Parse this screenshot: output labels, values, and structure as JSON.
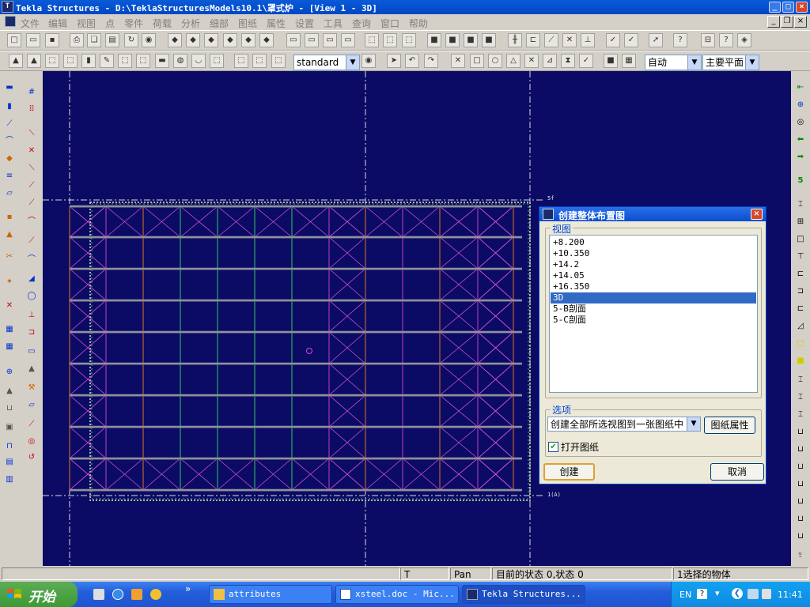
{
  "window": {
    "title": "Tekla Structures - D:\\TeklaStructuresModels10.1\\罩式炉 - [View 1 - 3D]"
  },
  "menu": [
    "文件",
    "编辑",
    "视图",
    "点",
    "零件",
    "荷载",
    "分析",
    "细部",
    "图纸",
    "属性",
    "设置",
    "工具",
    "查询",
    "窗口",
    "帮助"
  ],
  "toolbar2": {
    "standard_select": "standard",
    "auto_select": "自动",
    "plane_select": "主要平面"
  },
  "viewport": {
    "axis_label_top": "5f",
    "axis_label_bottom": "1(A)"
  },
  "dialog": {
    "title": "创建整体布置图",
    "views_group": "视图",
    "views": [
      "+8.200",
      "+10.350",
      "+14.2",
      "+14.05",
      "+16.350",
      "3D",
      "5-B剖面",
      "5-C剖面"
    ],
    "selected_view": "3D",
    "options_group": "选项",
    "option_select": "创建全部所选视图到一张图纸中",
    "drawing_props_button": "图纸属性",
    "open_drawing_checkbox": "打开图纸",
    "open_drawing_checked": true,
    "create_button": "创建",
    "cancel_button": "取消"
  },
  "statusbar": {
    "t_field": "T",
    "pan_field": "Pan",
    "state_field": "目前的状态 0,状态 0",
    "selection_field": "1选择的物体"
  },
  "taskbar": {
    "start": "开始",
    "tasks": [
      "attributes",
      "xsteel.doc - Mic...",
      "Tekla Structures..."
    ],
    "lang": "EN",
    "clock": "11:41"
  }
}
